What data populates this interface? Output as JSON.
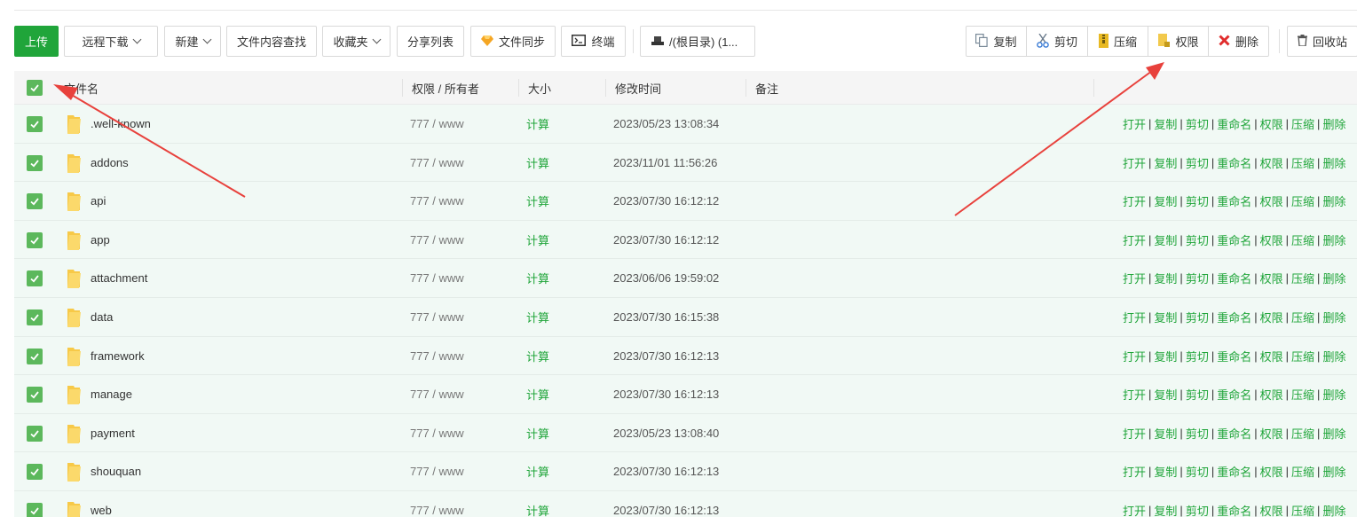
{
  "toolbar": {
    "upload": "上传",
    "remote_download": "远程下载",
    "new": "新建",
    "content_search": "文件内容查找",
    "favorites": "收藏夹",
    "share_list": "分享列表",
    "file_sync": "文件同步",
    "terminal": "终端",
    "path": "/(根目录) (1..."
  },
  "batch": {
    "copy": "复制",
    "cut": "剪切",
    "compress": "压缩",
    "permission": "权限",
    "delete": "删除",
    "recycle": "回收站"
  },
  "table": {
    "headers": {
      "name": "文件名",
      "perm": "权限 / 所有者",
      "size": "大小",
      "mtime": "修改时间",
      "note": "备注"
    },
    "ops": [
      "打开",
      "复制",
      "剪切",
      "重命名",
      "权限",
      "压缩",
      "删除"
    ],
    "rows": [
      {
        "name": ".well-known",
        "perm": "777 / www",
        "size": "计算",
        "mtime": "2023/05/23 13:08:34"
      },
      {
        "name": "addons",
        "perm": "777 / www",
        "size": "计算",
        "mtime": "2023/11/01 11:56:26"
      },
      {
        "name": "api",
        "perm": "777 / www",
        "size": "计算",
        "mtime": "2023/07/30 16:12:12"
      },
      {
        "name": "app",
        "perm": "777 / www",
        "size": "计算",
        "mtime": "2023/07/30 16:12:12"
      },
      {
        "name": "attachment",
        "perm": "777 / www",
        "size": "计算",
        "mtime": "2023/06/06 19:59:02"
      },
      {
        "name": "data",
        "perm": "777 / www",
        "size": "计算",
        "mtime": "2023/07/30 16:15:38"
      },
      {
        "name": "framework",
        "perm": "777 / www",
        "size": "计算",
        "mtime": "2023/07/30 16:12:13"
      },
      {
        "name": "manage",
        "perm": "777 / www",
        "size": "计算",
        "mtime": "2023/07/30 16:12:13"
      },
      {
        "name": "payment",
        "perm": "777 / www",
        "size": "计算",
        "mtime": "2023/05/23 13:08:40"
      },
      {
        "name": "shouquan",
        "perm": "777 / www",
        "size": "计算",
        "mtime": "2023/07/30 16:12:13"
      },
      {
        "name": "web",
        "perm": "777 / www",
        "size": "计算",
        "mtime": "2023/07/30 16:12:13"
      }
    ]
  },
  "colors": {
    "accent": "#20a53a",
    "checkbox": "#5cb85c",
    "row_bg": "#f1f9f5",
    "arrow": "#e8413c"
  }
}
